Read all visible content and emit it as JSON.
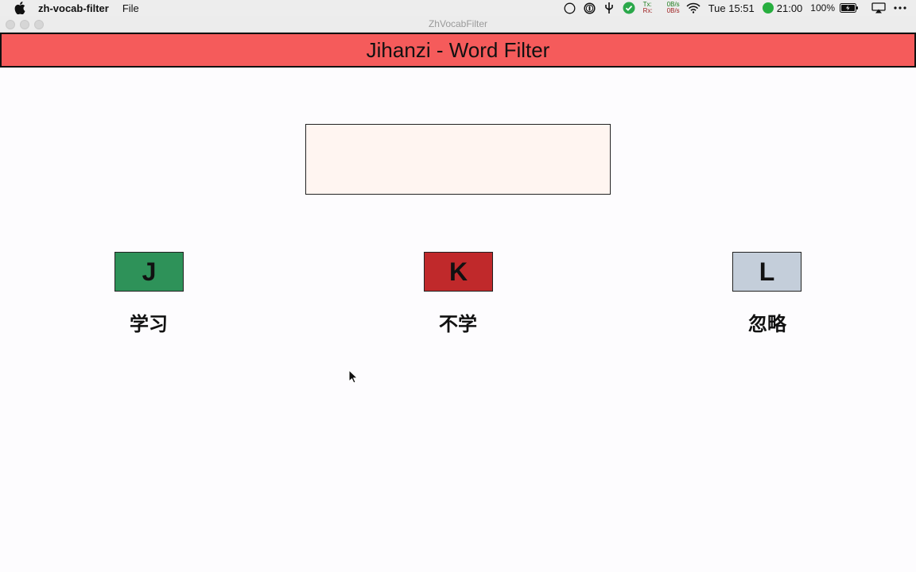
{
  "menubar": {
    "app_name": "zh-vocab-filter",
    "menus": [
      "File"
    ],
    "status": {
      "onepassword_glyph": "1",
      "net_tx_label": "Tx:",
      "net_tx_value": "0B/s",
      "net_rx_label": "Rx:",
      "net_rx_value": "0B/s",
      "clock": "Tue 15:51",
      "timer": "21:00",
      "battery": "100%"
    }
  },
  "window": {
    "title": "ZhVocabFilter"
  },
  "header": {
    "title": "Jihanzi - Word Filter",
    "color": "#f55b5b"
  },
  "word_display": {
    "text": ""
  },
  "actions": [
    {
      "key": "J",
      "label": "学习",
      "color": "#2e9259"
    },
    {
      "key": "K",
      "label": "不学",
      "color": "#c0292b"
    },
    {
      "key": "L",
      "label": "忽略",
      "color": "#c4ceda"
    }
  ]
}
